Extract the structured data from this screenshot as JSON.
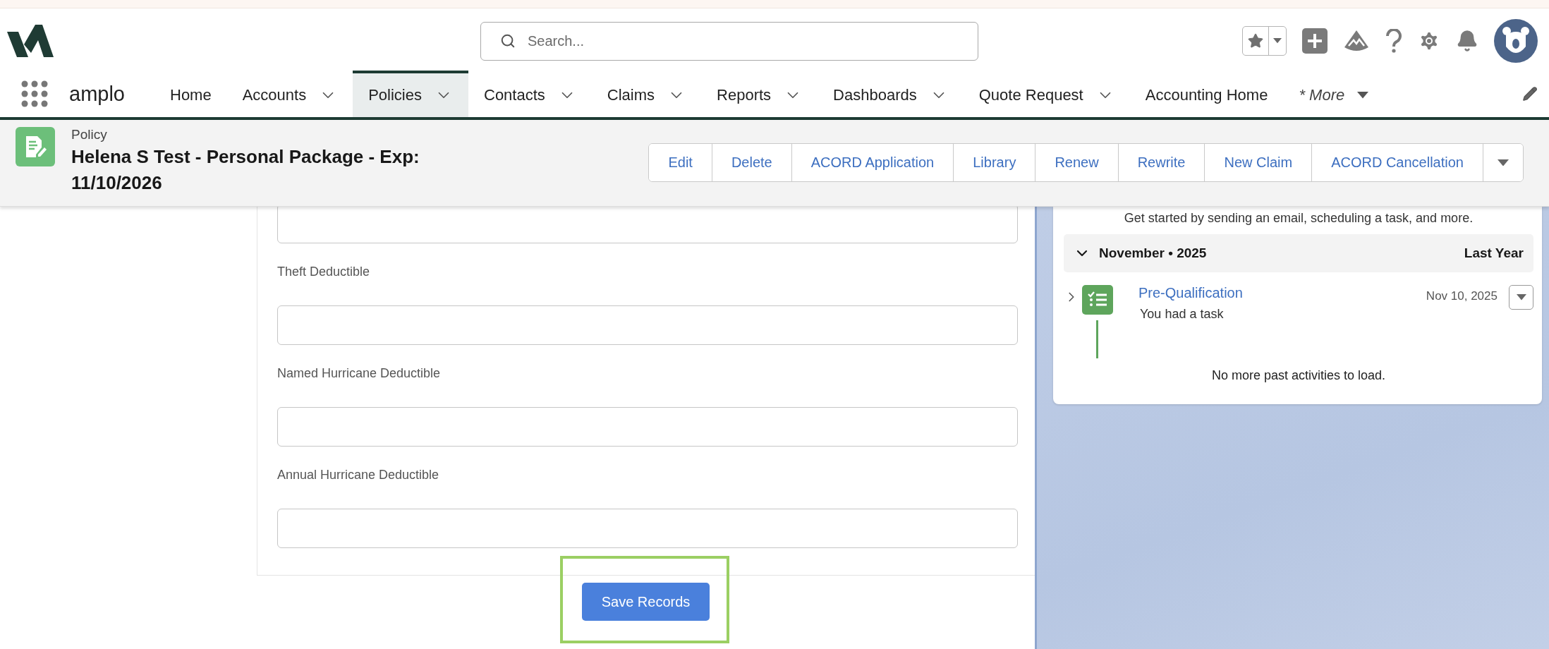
{
  "app": {
    "name": "amplo"
  },
  "search": {
    "placeholder": "Search..."
  },
  "nav": [
    {
      "label": "Home",
      "kind": "link",
      "selected": false
    },
    {
      "label": "Accounts",
      "kind": "menu",
      "selected": false
    },
    {
      "label": "Policies",
      "kind": "menu",
      "selected": true
    },
    {
      "label": "Contacts",
      "kind": "menu",
      "selected": false
    },
    {
      "label": "Claims",
      "kind": "menu",
      "selected": false
    },
    {
      "label": "Reports",
      "kind": "menu",
      "selected": false
    },
    {
      "label": "Dashboards",
      "kind": "menu",
      "selected": false
    },
    {
      "label": "Quote Request",
      "kind": "menu",
      "selected": false
    },
    {
      "label": "Accounting Home",
      "kind": "link",
      "selected": false
    },
    {
      "label": "* More",
      "kind": "more",
      "selected": false
    }
  ],
  "record": {
    "type": "Policy",
    "title": "Helena S Test - Personal Package - Exp: 11/10/2026"
  },
  "actions": [
    "Edit",
    "Delete",
    "ACORD Application",
    "Library",
    "Renew",
    "Rewrite",
    "New Claim",
    "ACORD Cancellation"
  ],
  "form": {
    "fields": [
      {
        "kind": "bare"
      },
      {
        "kind": "labeled",
        "label": "Theft Deductible"
      },
      {
        "kind": "labeled",
        "label": "Named Hurricane Deductible"
      },
      {
        "kind": "labeled",
        "label": "Annual Hurricane Deductible"
      }
    ],
    "save_button": {
      "label": "Save Records",
      "highlighted": true
    }
  },
  "activity": {
    "intro": "Get started by sending an email, scheduling a task, and more.",
    "group": {
      "title": "November • 2025",
      "period": "Last Year",
      "expanded": true
    },
    "items": [
      {
        "title": "Pre-Qualification",
        "date": "Nov 10, 2025",
        "subtitle": "You had a task",
        "expanded": false
      }
    ],
    "footer": "No more past activities to load."
  }
}
